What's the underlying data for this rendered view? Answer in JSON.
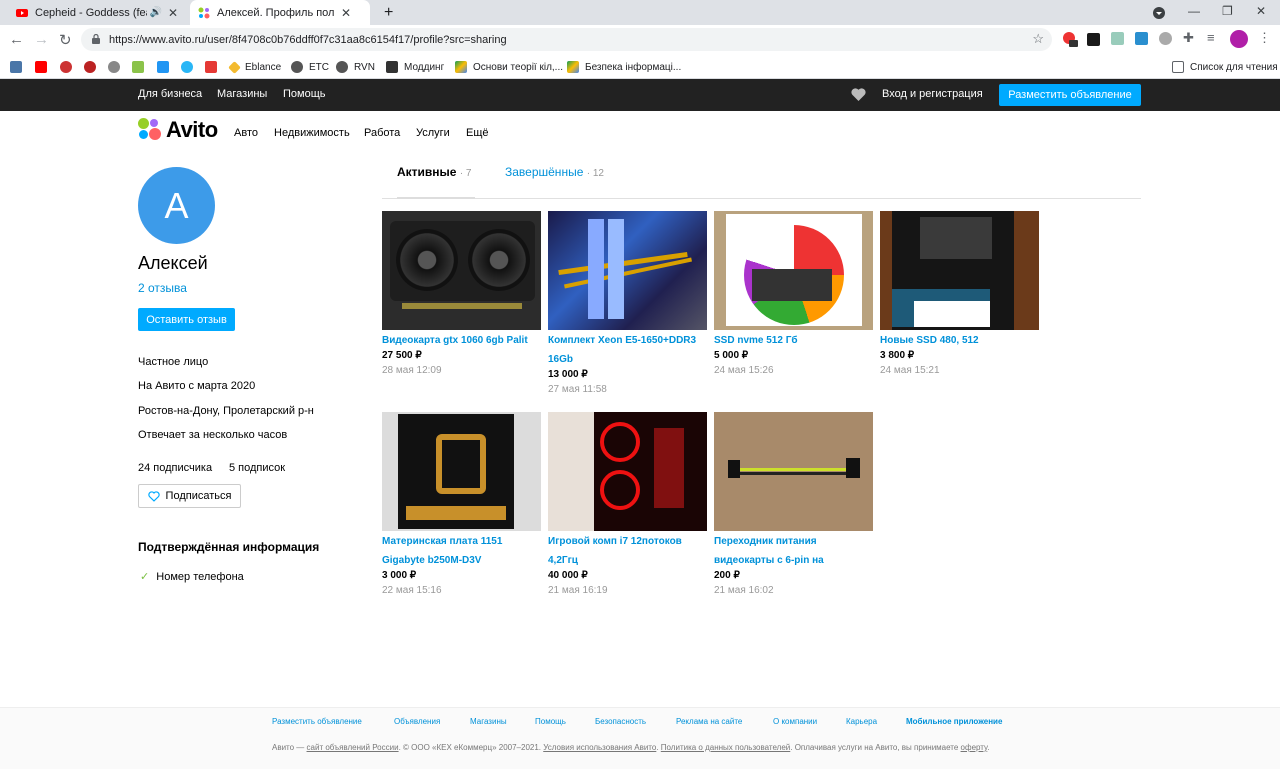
{
  "browser": {
    "tabs": [
      {
        "title": "Cepheid - Goddess (feat. No",
        "active": false
      },
      {
        "title": "Алексей. Профиль пользовате",
        "active": true
      }
    ],
    "url": "https://www.avito.ru/user/8f4708c0b76ddff0f7c31aa8c6154f17/profile?src=sharing",
    "bookmarks": [
      "Eblance",
      "ETC",
      "RVN",
      "Моддинг",
      "Основи теорії кіл,...",
      "Безпека інформаці..."
    ],
    "reading_list": "Список для чтения"
  },
  "topbar": {
    "links": [
      "Для бизнеса",
      "Магазины",
      "Помощь"
    ],
    "login": "Вход и регистрация",
    "post_ad": "Разместить объявление"
  },
  "header": {
    "logo": "Avito",
    "nav": [
      "Авто",
      "Недвижимость",
      "Работа",
      "Услуги",
      "Ещё"
    ]
  },
  "profile": {
    "avatar_letter": "А",
    "name": "Алексей",
    "reviews": "2 отзыва",
    "leave_review": "Оставить отзыв",
    "type": "Частное лицо",
    "since": "На Авито с марта 2020",
    "location": "Ростов-на-Дону, Пролетарский р-н",
    "response": "Отвечает за несколько часов",
    "subscribers": "24 подписчика",
    "subscriptions": "5 подписок",
    "subscribe": "Подписаться",
    "verified_title": "Подтверждённая информация",
    "verified_phone": "Номер телефона"
  },
  "tabs": {
    "active_label": "Активные",
    "active_count": "· 7",
    "done_label": "Завершённые",
    "done_count": "· 12"
  },
  "listings": [
    {
      "title": "Видеокарта gtx 1060 6gb Palit",
      "price": "27 500 ₽",
      "date": "28 мая 12:09"
    },
    {
      "title": "Комплект Xeon E5-1650+DDR3 16Gb",
      "price": "13 000 ₽",
      "date": "27 мая 11:58"
    },
    {
      "title": "SSD nvme 512 Гб",
      "price": "5 000 ₽",
      "date": "24 мая 15:26"
    },
    {
      "title": "Новые SSD 480, 512",
      "price": "3 800 ₽",
      "date": "24 мая 15:21"
    },
    {
      "title": "Материнская плата 1151 Gigabyte b250M-D3V",
      "price": "3 000 ₽",
      "date": "22 мая 15:16"
    },
    {
      "title": "Игровой комп i7 12потоков 4,2Ггц",
      "price": "40 000 ₽",
      "date": "21 мая 16:19"
    },
    {
      "title": "Переходник питания видеокарты с 6-pin на",
      "price": "200 ₽",
      "date": "21 мая 16:02"
    }
  ],
  "footer": {
    "links": [
      "Разместить объявление",
      "Объявления",
      "Магазины",
      "Помощь",
      "Безопасность",
      "Реклама на сайте",
      "О компании",
      "Карьера",
      "Мобильное приложение"
    ],
    "copy_1": "Авито — ",
    "copy_link1": "сайт объявлений России",
    "copy_2": ". © ООО «КЕХ еКоммерц» 2007–2021. ",
    "copy_link2": "Условия использования Авито",
    "copy_3": ". ",
    "copy_link3": "Политика о данных пользователей",
    "copy_4": ". Оплачивая услуги на Авито, вы принимаете ",
    "copy_link4": "оферту",
    "copy_5": "."
  }
}
